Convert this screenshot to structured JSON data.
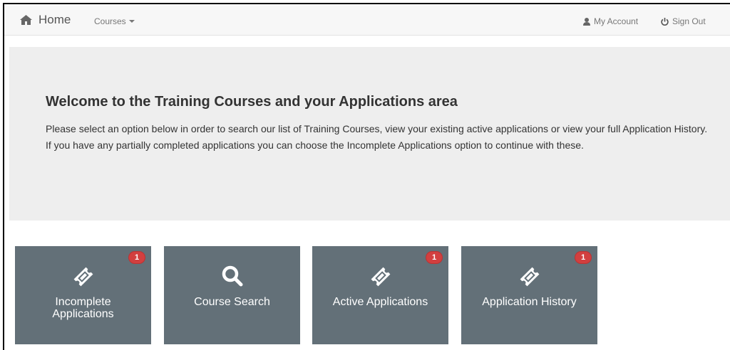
{
  "nav": {
    "home_label": "Home",
    "courses_label": "Courses",
    "account_label": "My Account",
    "signout_label": "Sign Out"
  },
  "hero": {
    "title": "Welcome to the Training Courses and your Applications area",
    "body": "Please select an option below in order to search our list of Training Courses, view your existing active applications or view your full Application History. If you have any partially completed applications you can choose the Incomplete Applications option to continue with these."
  },
  "tiles": [
    {
      "label": "Incomplete Applications",
      "badge": "1",
      "icon": "ticket-icon"
    },
    {
      "label": "Course Search",
      "badge": "",
      "icon": "search-icon"
    },
    {
      "label": "Active Applications",
      "badge": "1",
      "icon": "ticket-icon"
    },
    {
      "label": "Application History",
      "badge": "1",
      "icon": "ticket-icon"
    }
  ],
  "colors": {
    "tile_bg": "#637078",
    "hero_bg": "#eeeeee",
    "badge_bg": "#d23f3f"
  }
}
